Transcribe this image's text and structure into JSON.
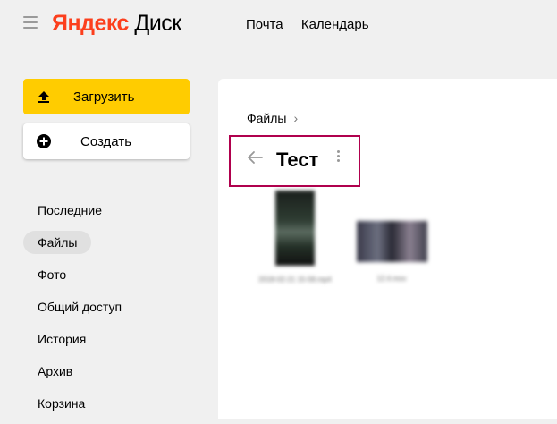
{
  "header": {
    "logo_ya": "Яндекс",
    "logo_disk": "Диск",
    "nav": [
      "Почта",
      "Календарь"
    ]
  },
  "sidebar": {
    "upload_label": "Загрузить",
    "create_label": "Создать",
    "items": [
      {
        "label": "Последние"
      },
      {
        "label": "Файлы",
        "active": true
      },
      {
        "label": "Фото"
      },
      {
        "label": "Общий доступ"
      },
      {
        "label": "История"
      },
      {
        "label": "Архив"
      },
      {
        "label": "Корзина"
      }
    ]
  },
  "main": {
    "breadcrumb": "Файлы",
    "folder_title": "Тест",
    "files": [
      {
        "caption": "2018-02-21 15-58.mp4"
      },
      {
        "caption": "12.4.mov"
      }
    ]
  },
  "colors": {
    "brand_red": "#fc3f1d",
    "upload_yellow": "#ffcc00",
    "highlight_frame": "#b0004d"
  },
  "icons": [
    "menu-icon",
    "upload-icon",
    "plus-circle-icon",
    "chevron-right-icon",
    "arrow-left-icon",
    "more-vertical-icon"
  ]
}
